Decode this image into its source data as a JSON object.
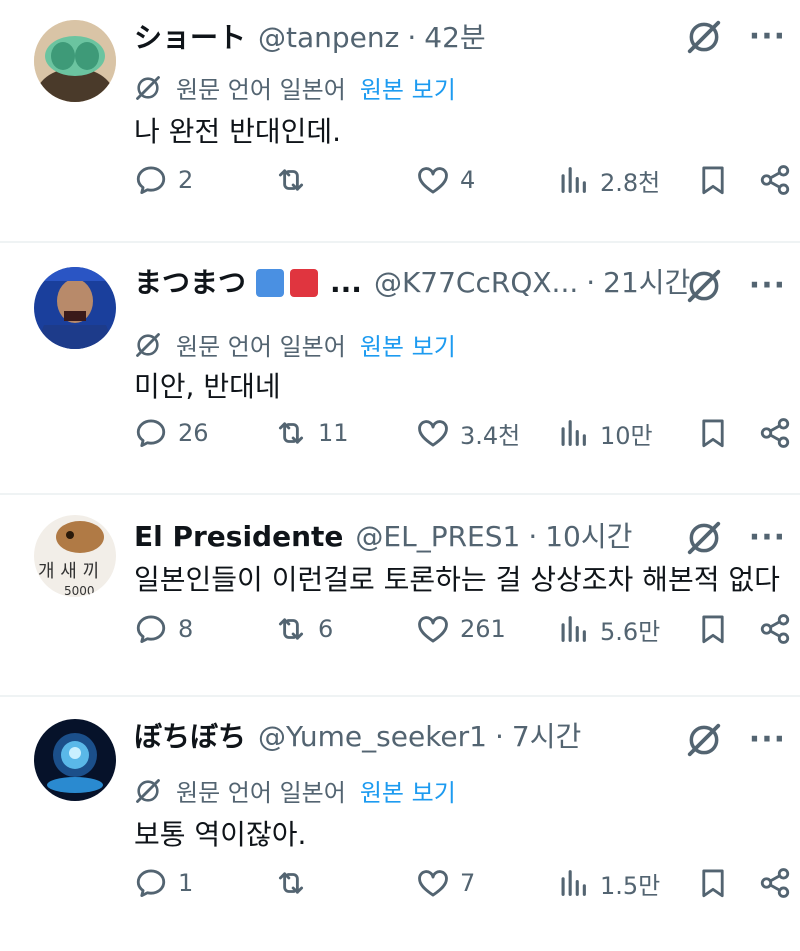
{
  "ui": {
    "more_label": "···",
    "translate_label": "원문 언어 일본어",
    "view_original_label": "원본 보기",
    "separator": "·"
  },
  "tweets": [
    {
      "name": "ショート",
      "handle": "@tanpenz",
      "time": "42분",
      "text": "나 완전 반대인데.",
      "replies": "2",
      "retweets": "",
      "likes": "4",
      "views": "2.8천"
    },
    {
      "name": "まつまつ",
      "name_suffix": "...",
      "handle": "@K77CcRQX...",
      "time": "21시간",
      "text": "미안, 반대네",
      "replies": "26",
      "retweets": "11",
      "likes": "3.4천",
      "views": "10만",
      "badge_colors": [
        "#4a90e2",
        "#e0353f"
      ]
    },
    {
      "name": "El Presidente",
      "handle": "@EL_PRES1",
      "time": "10시간",
      "text": "일본인들이 이런걸로 토론하는 걸 상상조차 해본적 없다",
      "replies": "8",
      "retweets": "6",
      "likes": "261",
      "views": "5.6만"
    },
    {
      "name": "ぼちぼち",
      "handle": "@Yume_seeker1",
      "time": "7시간",
      "text": "보통 역이잖아.",
      "replies": "1",
      "retweets": "",
      "likes": "7",
      "views": "1.5만"
    }
  ]
}
